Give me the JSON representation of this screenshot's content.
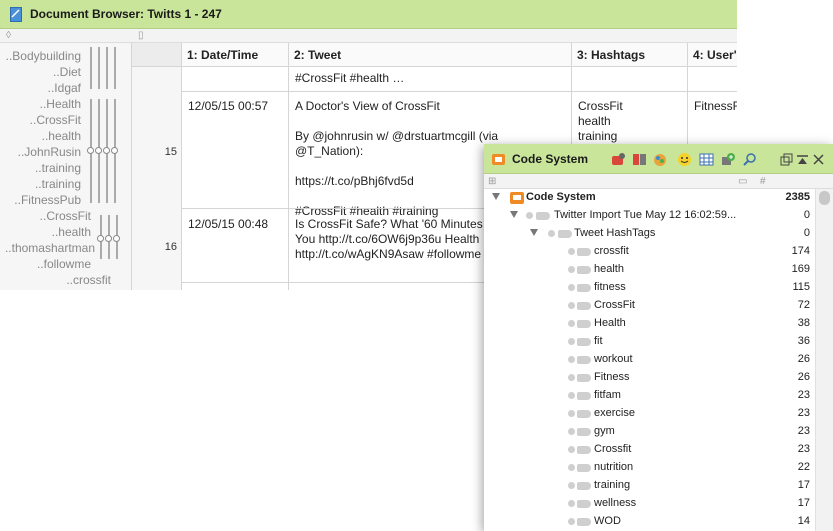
{
  "doc_browser": {
    "title": "Document Browser: Twitts 1 - 247",
    "tree_labels": [
      "..Bodybuilding",
      "..Diet",
      "..Idgaf",
      "..Health",
      "..CrossFit",
      "..health",
      "..JohnRusin",
      "..training",
      "..training",
      "..FitnessPub",
      "..CrossFit",
      "..health",
      "..thomashartman",
      "..followme",
      "..crossfit"
    ],
    "columns": [
      "1: Date/Time",
      "2: Tweet",
      "3: Hashtags",
      "4: User's"
    ],
    "row_prev": {
      "tweet": "#CrossFit #health …"
    },
    "rows": [
      {
        "num": "15",
        "datetime": "12/05/15 00:57",
        "tweet": "A Doctor's View of CrossFit\n\nBy @johnrusin w/ @drstuartmcgill (via @T_Nation):\n\nhttps://t.co/pBhj6fvd5d\n\n#CrossFit #health #training",
        "hashtags": "CrossFit\nhealth\ntraining",
        "user": "FitnessF"
      },
      {
        "num": "16",
        "datetime": "12/05/15 00:48",
        "tweet": "Is CrossFit Safe? What '60 Minutes\nYou http://t.co/6OW6j9p36u Health\nhttp://t.co/wAgKN9Asaw #followme",
        "hashtags": "",
        "user": ""
      }
    ]
  },
  "code_system": {
    "title": "Code System",
    "colors": {
      "titlebar": "#c9e59a",
      "accent": "#f08a24"
    },
    "items": [
      {
        "label": "Code System",
        "count": "2385"
      },
      {
        "label": "Twitter Import Tue May 12 16:02:59...",
        "count": "0"
      },
      {
        "label": "Tweet HashTags",
        "count": "0"
      },
      {
        "label": "crossfit",
        "count": "174"
      },
      {
        "label": "health",
        "count": "169"
      },
      {
        "label": "fitness",
        "count": "115"
      },
      {
        "label": "CrossFit",
        "count": "72"
      },
      {
        "label": "Health",
        "count": "38"
      },
      {
        "label": "fit",
        "count": "36"
      },
      {
        "label": "workout",
        "count": "26"
      },
      {
        "label": "Fitness",
        "count": "26"
      },
      {
        "label": "fitfam",
        "count": "23"
      },
      {
        "label": "exercise",
        "count": "23"
      },
      {
        "label": "gym",
        "count": "23"
      },
      {
        "label": "Crossfit",
        "count": "23"
      },
      {
        "label": "nutrition",
        "count": "22"
      },
      {
        "label": "training",
        "count": "17"
      },
      {
        "label": "wellness",
        "count": "17"
      },
      {
        "label": "WOD",
        "count": "14"
      }
    ]
  }
}
